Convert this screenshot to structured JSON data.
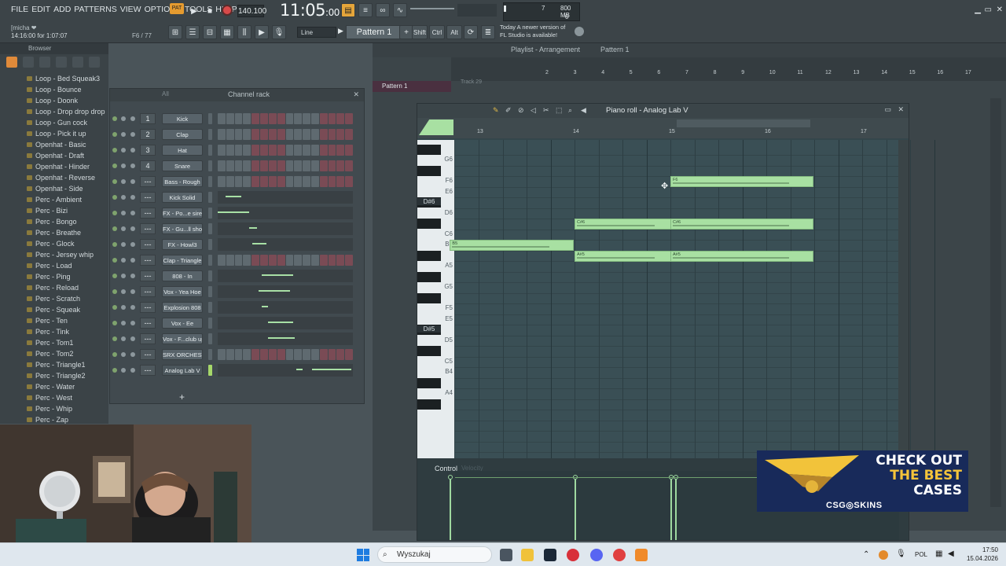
{
  "menu": [
    "FILE",
    "EDIT",
    "ADD",
    "PATTERNS",
    "VIEW",
    "OPTIONS",
    "TOOLS",
    "HELP"
  ],
  "hint": {
    "user": "[micha ❤",
    "time_info": "14:16:00 for 1:07:07",
    "pct": "F6 / 77"
  },
  "transport": {
    "pat_label": "PAT",
    "tempo": "140.100",
    "clock": "11:05",
    "clock_small": ":00"
  },
  "cpu": {
    "mem": "800 MB",
    "poly": "7",
    "zero": "0"
  },
  "news": {
    "line1": "Today  A newer version of",
    "line2": "FL Studio is available!"
  },
  "toolbar": {
    "pattern": "Pattern 1",
    "snap": "Line",
    "shift": "Shift",
    "ctrl": "Ctrl",
    "alt": "Alt"
  },
  "browser": {
    "title": "Browser",
    "items": [
      "Loop - Bed Squeak3",
      "Loop - Bounce",
      "Loop - Doonk",
      "Loop - Drop drop drop",
      "Loop - Gun cock",
      "Loop - Pick it up",
      "Openhat - Basic",
      "Openhat - Draft",
      "Openhat - Hinder",
      "Openhat - Reverse",
      "Openhat - Side",
      "Perc - Ambient",
      "Perc - Bizi",
      "Perc - Bongo",
      "Perc - Breathe",
      "Perc - Glock",
      "Perc - Jersey whip",
      "Perc - Load",
      "Perc - Ping",
      "Perc - Reload",
      "Perc - Scratch",
      "Perc - Squeak",
      "Perc - Ten",
      "Perc - Tink",
      "Perc - Tom1",
      "Perc - Tom2",
      "Perc - Triangle1",
      "Perc - Triangle2",
      "Perc - Water",
      "Perc - West",
      "Perc - Whip",
      "Perc - Zap"
    ]
  },
  "channel_rack": {
    "title": "Channel rack",
    "filter": "All",
    "channels": [
      {
        "num": "1",
        "name": "Kick"
      },
      {
        "num": "2",
        "name": "Clap"
      },
      {
        "num": "3",
        "name": "Hat"
      },
      {
        "num": "4",
        "name": "Snare"
      },
      {
        "num": "---",
        "name": "Bass - Rough"
      },
      {
        "num": "---",
        "name": "Kick Solid"
      },
      {
        "num": "---",
        "name": "FX - Po...e siren"
      },
      {
        "num": "---",
        "name": "FX - Gu...ll shot"
      },
      {
        "num": "---",
        "name": "FX - Howl3"
      },
      {
        "num": "---",
        "name": "Clap - Triangle"
      },
      {
        "num": "---",
        "name": "808 - In"
      },
      {
        "num": "---",
        "name": "Vox - Yea Hoe"
      },
      {
        "num": "---",
        "name": "Explosion 808"
      },
      {
        "num": "---",
        "name": "Vox - Ee"
      },
      {
        "num": "---",
        "name": "Vox - F...club up"
      },
      {
        "num": "---",
        "name": "SRX ORCHESTRA"
      },
      {
        "num": "---",
        "name": "Analog Lab V"
      }
    ],
    "add": "+"
  },
  "playlist": {
    "title": "Playlist - Arrangement",
    "pattern": "Pattern 1",
    "track": "Pattern 1",
    "track_label": "Track 29",
    "bars": [
      "2",
      "3",
      "4",
      "5",
      "6",
      "7",
      "8",
      "9",
      "10",
      "11",
      "12",
      "13",
      "14",
      "15",
      "16",
      "17"
    ]
  },
  "piano_roll": {
    "title": "Piano roll - Analog Lab V",
    "bars": [
      "13",
      "14",
      "15",
      "16",
      "17"
    ],
    "keys": [
      "G6",
      "F6",
      "E6",
      "D#6",
      "D6",
      "C6",
      "B5",
      "A5",
      "G5",
      "F5",
      "E5",
      "D#5",
      "D5",
      "C5",
      "B4",
      "A4"
    ],
    "notes": [
      {
        "label": "F6",
        "pitch": "F6",
        "start": 15,
        "length": 1.5
      },
      {
        "label": "C#6",
        "pitch": "C#6",
        "start": 14,
        "length": 1.1
      },
      {
        "label": "C#6",
        "pitch": "C#6",
        "start": 15,
        "length": 1.5
      },
      {
        "label": "B5",
        "pitch": "B5",
        "start": 12.7,
        "length": 1.3
      },
      {
        "label": "A#5",
        "pitch": "A#5",
        "start": 14,
        "length": 1.1
      },
      {
        "label": "A#5",
        "pitch": "A#5",
        "start": 15,
        "length": 1.5
      }
    ],
    "control_label": "Control",
    "control_target": "Velocity"
  },
  "ad": {
    "line1": "CHECK OUT",
    "line2": "THE BEST",
    "line3": "CASES",
    "brand": "CSG◎SKINS"
  },
  "taskbar": {
    "search": "Wyszukaj",
    "lang": "POL",
    "time": "17:50",
    "date": "15.04.2026"
  },
  "colors": {
    "note": "#a8e0a2",
    "accent": "#f5c43a",
    "ad_bg": "#182a5a"
  }
}
